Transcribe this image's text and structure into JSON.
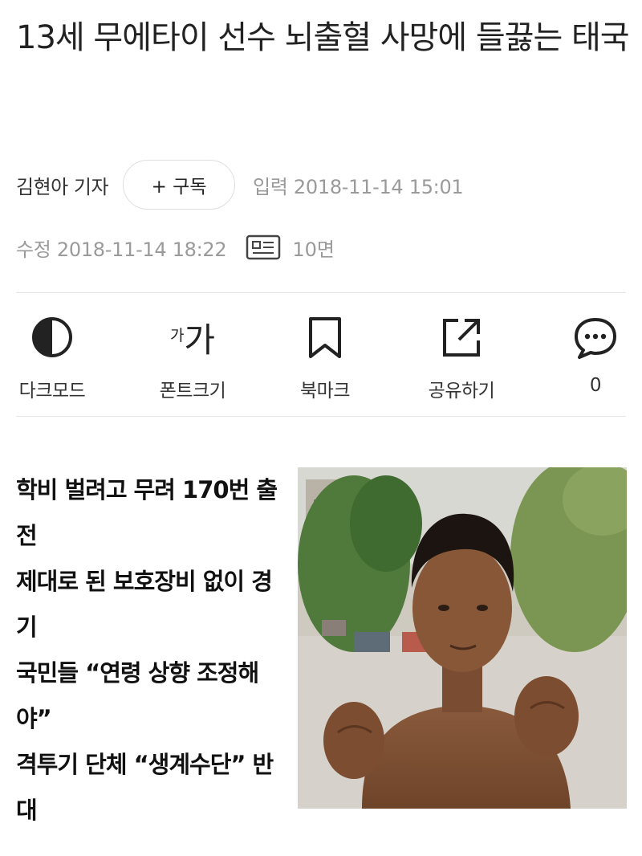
{
  "article": {
    "title": "13세 무에타이 선수 뇌출혈 사망에 들끓는 태국",
    "reporter": "김현아 기자",
    "subscribe_label": "+ 구독",
    "input_date": "입력 2018-11-14 15:01",
    "modified_date": "수정 2018-11-14 18:22",
    "page_number": "10면",
    "summary": [
      "학비 벌려고 무려 170번 출전",
      "제대로 된 보호장비 없이 경기",
      "국민들 “연령 상향 조정해야”",
      "격투기 단체 “생계수단” 반대"
    ]
  },
  "toolbar": {
    "dark_mode_label": "다크모드",
    "font_size_label": "폰트크기",
    "font_glyph_small": "가",
    "font_glyph_big": "가",
    "bookmark_label": "북마크",
    "share_label": "공유하기",
    "comment_count": "0"
  },
  "icons": {
    "paper": "newspaper-icon",
    "dark_mode": "half-circle-icon",
    "bookmark": "bookmark-icon",
    "share": "share-icon",
    "comment": "speech-bubble-icon"
  },
  "colors": {
    "text": "#222222",
    "muted": "#9a9a9a",
    "divider": "#e6e6e6"
  }
}
